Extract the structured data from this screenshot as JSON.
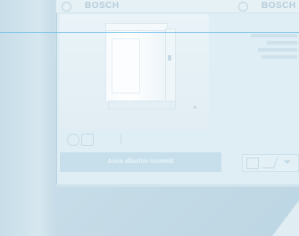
{
  "header": {
    "logo_left": "BOSCH",
    "logo_right": "BOSCH"
  },
  "product": {
    "image": "appliance-product-photo"
  },
  "actions": {
    "primary_label": "Aoca aflachm msmeld"
  },
  "icons": [
    "brand-icon",
    "user-icon",
    "grid-icon",
    "print-icon",
    "edit-icon",
    "chevron-down-icon"
  ],
  "colors": {
    "screen_bg": "#dfeef5",
    "accent_line": "#6fbfe9",
    "button_bg": "#c7dfeb"
  }
}
